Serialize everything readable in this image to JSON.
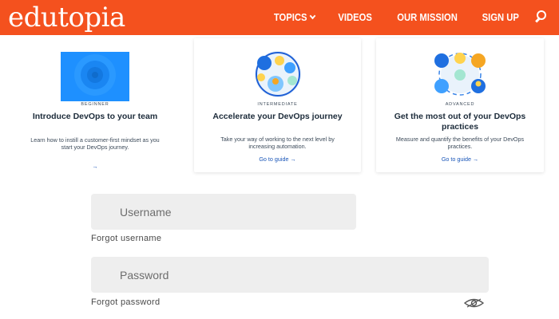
{
  "header": {
    "logo": "edutopia",
    "background": "#f4511e",
    "nav": [
      {
        "label": "TOPICS",
        "has_dropdown": true
      },
      {
        "label": "VIDEOS"
      },
      {
        "label": "OUR MISSION"
      },
      {
        "label": "SIGN UP"
      }
    ],
    "search_icon": "search-icon"
  },
  "cards": [
    {
      "level": "BEGINNER",
      "title": "Introduce DevOps to your team",
      "description": "Learn how to instill a customer-first mindset as you start your DevOps journey.",
      "link": "→",
      "image_color": "#1e90ff"
    },
    {
      "level": "INTERMEDIATE",
      "title": "Accelerate your DevOps journey",
      "description": "Take your way of working to the next level by increasing automation.",
      "link": "Go to guide →"
    },
    {
      "level": "ADVANCED",
      "title": "Get the most out of your DevOps practices",
      "description": "Measure and quantify the benefits of your DevOps practices.",
      "link": "Go to guide →"
    }
  ],
  "form": {
    "username_placeholder": "Username",
    "forgot_username": "Forgot username",
    "password_placeholder": "Password",
    "forgot_password": "Forgot password",
    "show_password_icon": "eye-icon"
  }
}
